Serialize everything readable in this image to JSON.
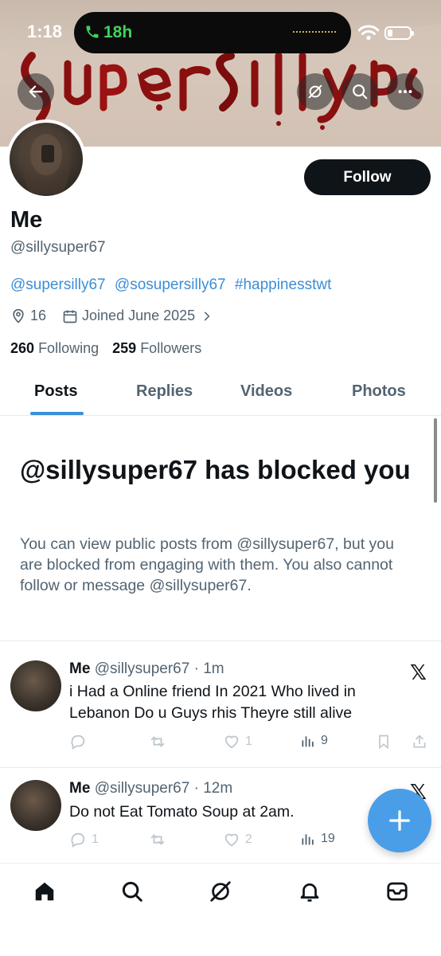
{
  "status_bar": {
    "time": "1:18",
    "call_duration": "18h"
  },
  "banner": {
    "back_icon": "arrow-left-icon",
    "grok_icon": "grok-icon",
    "search_icon": "search-icon",
    "more_icon": "more-icon"
  },
  "profile": {
    "follow_label": "Follow",
    "name": "Me",
    "handle": "@sillysuper67",
    "bio_links": [
      "@supersilly67",
      "@sosupersilly67",
      "#happinesstwt"
    ],
    "location": "16",
    "joined": "Joined June 2025",
    "following_count": "260",
    "following_label": "Following",
    "followers_count": "259",
    "followers_label": "Followers"
  },
  "tabs": [
    "Posts",
    "Replies",
    "Videos",
    "Photos"
  ],
  "blocked": {
    "title": "@sillysuper67 has blocked you",
    "text": "You can view public posts from @sillysuper67, but you are blocked from engaging with them. You also cannot follow or message @sillysuper67."
  },
  "posts": [
    {
      "name": "Me",
      "handle": "@sillysuper67",
      "time": "· 1m",
      "text": "i Had a Online friend In 2021 Who lived in Lebanon Do u Guys rhis Theyre still alive",
      "replies": "",
      "reposts": "",
      "likes": "1",
      "views": "9"
    },
    {
      "name": "Me",
      "handle": "@sillysuper67",
      "time": "· 12m",
      "text": "Do not Eat Tomato Soup at 2am.",
      "replies": "1",
      "reposts": "",
      "likes": "2",
      "views": "19"
    }
  ],
  "bottom_nav": [
    "home-icon",
    "search-icon",
    "grok-icon",
    "notifications-icon",
    "messages-icon"
  ]
}
